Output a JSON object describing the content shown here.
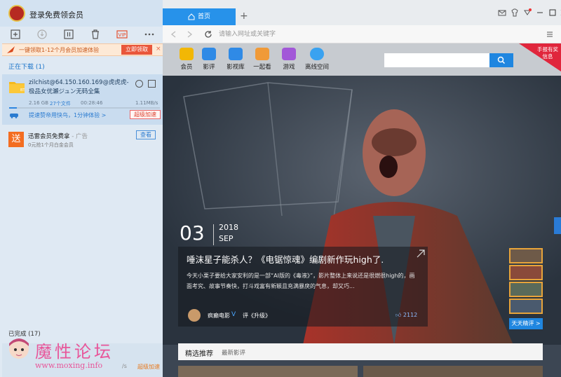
{
  "left_panel": {
    "login_text": "登录免费领会员",
    "promo": {
      "text": "一键领取1-12个月会员加速体验",
      "button": "立即领取",
      "close": "×"
    },
    "downloading_header": "正在下载 (1)",
    "task": {
      "name": "zilchist@64.150.160.169@虎虎虎-极品女优瀬ジュン无码全集",
      "size": "2.16 GB",
      "files": "27个文件",
      "time": "00:28:46",
      "speed": "1.11MB/s",
      "progress": 0.05,
      "speedup_text": "提速赞帝用快鸟，1分钟体验 >",
      "super_button": "超级加速"
    },
    "ad": {
      "icon_text": "送",
      "title": "迅雷会员免费拿",
      "title_suffix": "- 广告",
      "subtitle": "0元抢1个月白金会员",
      "button": "查看"
    },
    "completed_header": "已完成 (17)",
    "watermark": {
      "title": "魔性论坛",
      "url": "www.moxing.info"
    },
    "bottom_speed": "/s",
    "bottom_super": "超级加速"
  },
  "browser": {
    "tab_home": "首页",
    "tab_add": "+",
    "url_placeholder": "请输入网址或关键字"
  },
  "page": {
    "nav": [
      {
        "label": "会员",
        "color": "#f2b705"
      },
      {
        "label": "影评",
        "color": "#2f8ae6"
      },
      {
        "label": "影视库",
        "color": "#2f8ae6"
      },
      {
        "label": "一起看",
        "color": "#f09a38"
      },
      {
        "label": "游戏",
        "color": "#a258d8"
      },
      {
        "label": "离线空间",
        "color": "#3aa2f0"
      }
    ],
    "corner_badge": "手报有奖信息",
    "date_day": "03",
    "date_year": "2018",
    "date_month": "SEP",
    "headline": "唾沫星子能杀人？《电锯惊魂》编剧新作玩high了.",
    "summary": "今天小栗子要给大家安利的是一部“AI版的《毒液》”，影片整体上来说还是很燃很high的，画面考究、故事节奏快，打斗戏富有新颖且充满暴戾的气息，却又巧...",
    "author": "疯癫电影",
    "author_badge": "V",
    "review_target": "评《升级》",
    "likes": "2112",
    "daily_button": "天天精评 >",
    "section_title": "精选推荐",
    "section_subtitle": "最新影评"
  }
}
